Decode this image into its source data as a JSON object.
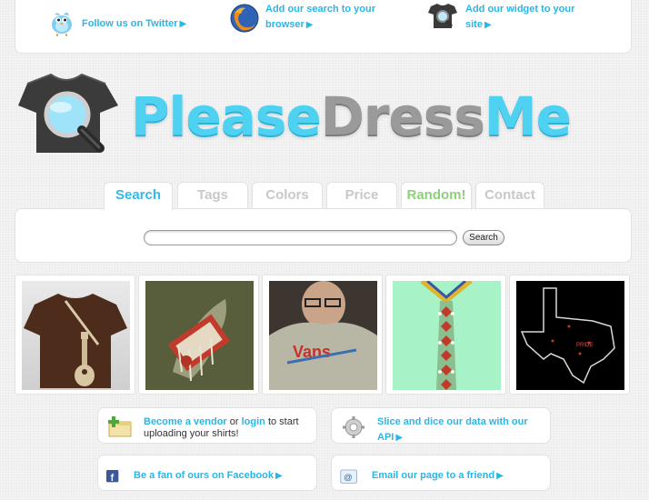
{
  "topbar": {
    "twitter": {
      "line1": "Follow us on Twitter",
      "icon": "twitter-bird-icon"
    },
    "firefox": {
      "line1": "Add our search to your",
      "line2": "browser",
      "icon": "firefox-icon"
    },
    "widget": {
      "line1": "Add our widget to your",
      "line2": "site",
      "icon": "tshirt-magnifier-icon"
    }
  },
  "logo": {
    "part1": "Please",
    "part2": "Dress",
    "part3": "Me"
  },
  "tabs": [
    {
      "label": "Search",
      "active": true
    },
    {
      "label": "Tags"
    },
    {
      "label": "Colors"
    },
    {
      "label": "Price"
    },
    {
      "label": "Random!"
    },
    {
      "label": "Contact"
    }
  ],
  "search": {
    "placeholder": "",
    "button_label": "Search"
  },
  "gallery": [
    {
      "name": "brown guitar tee"
    },
    {
      "name": "all people level graphic tee"
    },
    {
      "name": "man in vans tee"
    },
    {
      "name": "necktie pattern tee"
    },
    {
      "name": "texas map tee",
      "text": "PRIDE"
    }
  ],
  "cards": {
    "vendor": {
      "become": "Become a vendor",
      "or": " or ",
      "login": "login",
      "rest": " to start uploading your shirts!"
    },
    "api": {
      "line1": "Slice and dice our data with our",
      "line2": "API"
    },
    "facebook": {
      "line1": "Be a fan of ours on Facebook"
    },
    "email": {
      "line1": "Email our page to a friend"
    }
  },
  "colors": {
    "accent": "#2ab6e6",
    "logo_blue": "#4fd1f2",
    "logo_gray": "#9a9a9a",
    "random_green": "#8ed07a"
  }
}
